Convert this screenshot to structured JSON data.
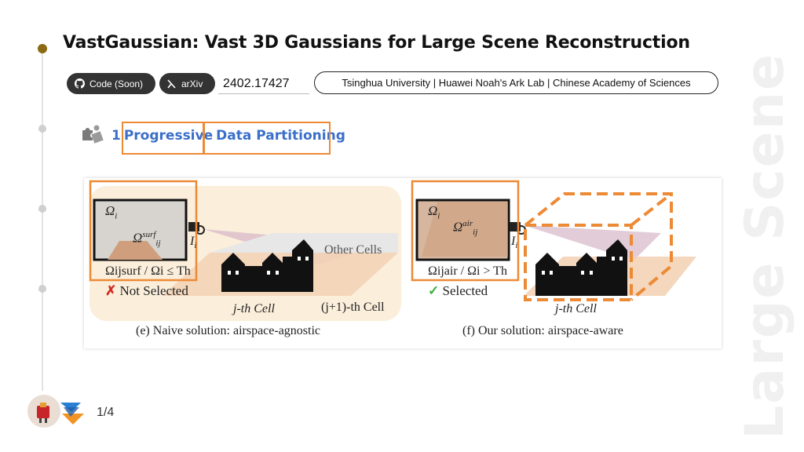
{
  "title": "VastGaussian: Vast 3D Gaussians for Large Scene Reconstruction",
  "badges": {
    "code": {
      "label": "Code (Soon)",
      "icon": "github-icon"
    },
    "arxiv": {
      "label": "arXiv",
      "icon": "arxiv-icon"
    }
  },
  "arxiv_id": "2402.17427",
  "affiliations": "Tsinghua University | Huawei Noah's Ark Lab | Chinese Academy of Sciences",
  "section": {
    "number": "1",
    "word1": "Progressive",
    "word2": "Data Partitioning",
    "icon": "puzzle-icon"
  },
  "figure": {
    "left": {
      "omega_i": "Ω",
      "omega_i_sub": "i",
      "omega_surf": "Ω",
      "omega_surf_sup": "surf",
      "omega_surf_sub": "ij",
      "camera_label": "I",
      "camera_sub": "i",
      "other_cells": "Other Cells",
      "condition": "Ωijsurf / Ωi ≤ Th",
      "status_mark": "✗",
      "status": "Not Selected",
      "jth_cell": "j-th Cell",
      "j1th_cell": "(j+1)-th Cell",
      "caption": "(e) Naive solution: airspace-agnostic"
    },
    "right": {
      "omega_i": "Ω",
      "omega_i_sub": "i",
      "omega_air": "Ω",
      "omega_air_sup": "air",
      "omega_air_sub": "ij",
      "camera_label": "I",
      "camera_sub": "i",
      "condition": "Ωijair / Ωi > Th",
      "status_mark": "✓",
      "status": "Selected",
      "jth_cell": "j-th Cell",
      "caption": "(f) Our solution: airspace-aware"
    }
  },
  "watermark": "Large Scene",
  "page": "1/4",
  "colors": {
    "accent_orange": "#ec8a36",
    "heading_blue": "#3b6fc9",
    "timeline_active": "#8a6a12",
    "badge_bg": "#333333"
  }
}
